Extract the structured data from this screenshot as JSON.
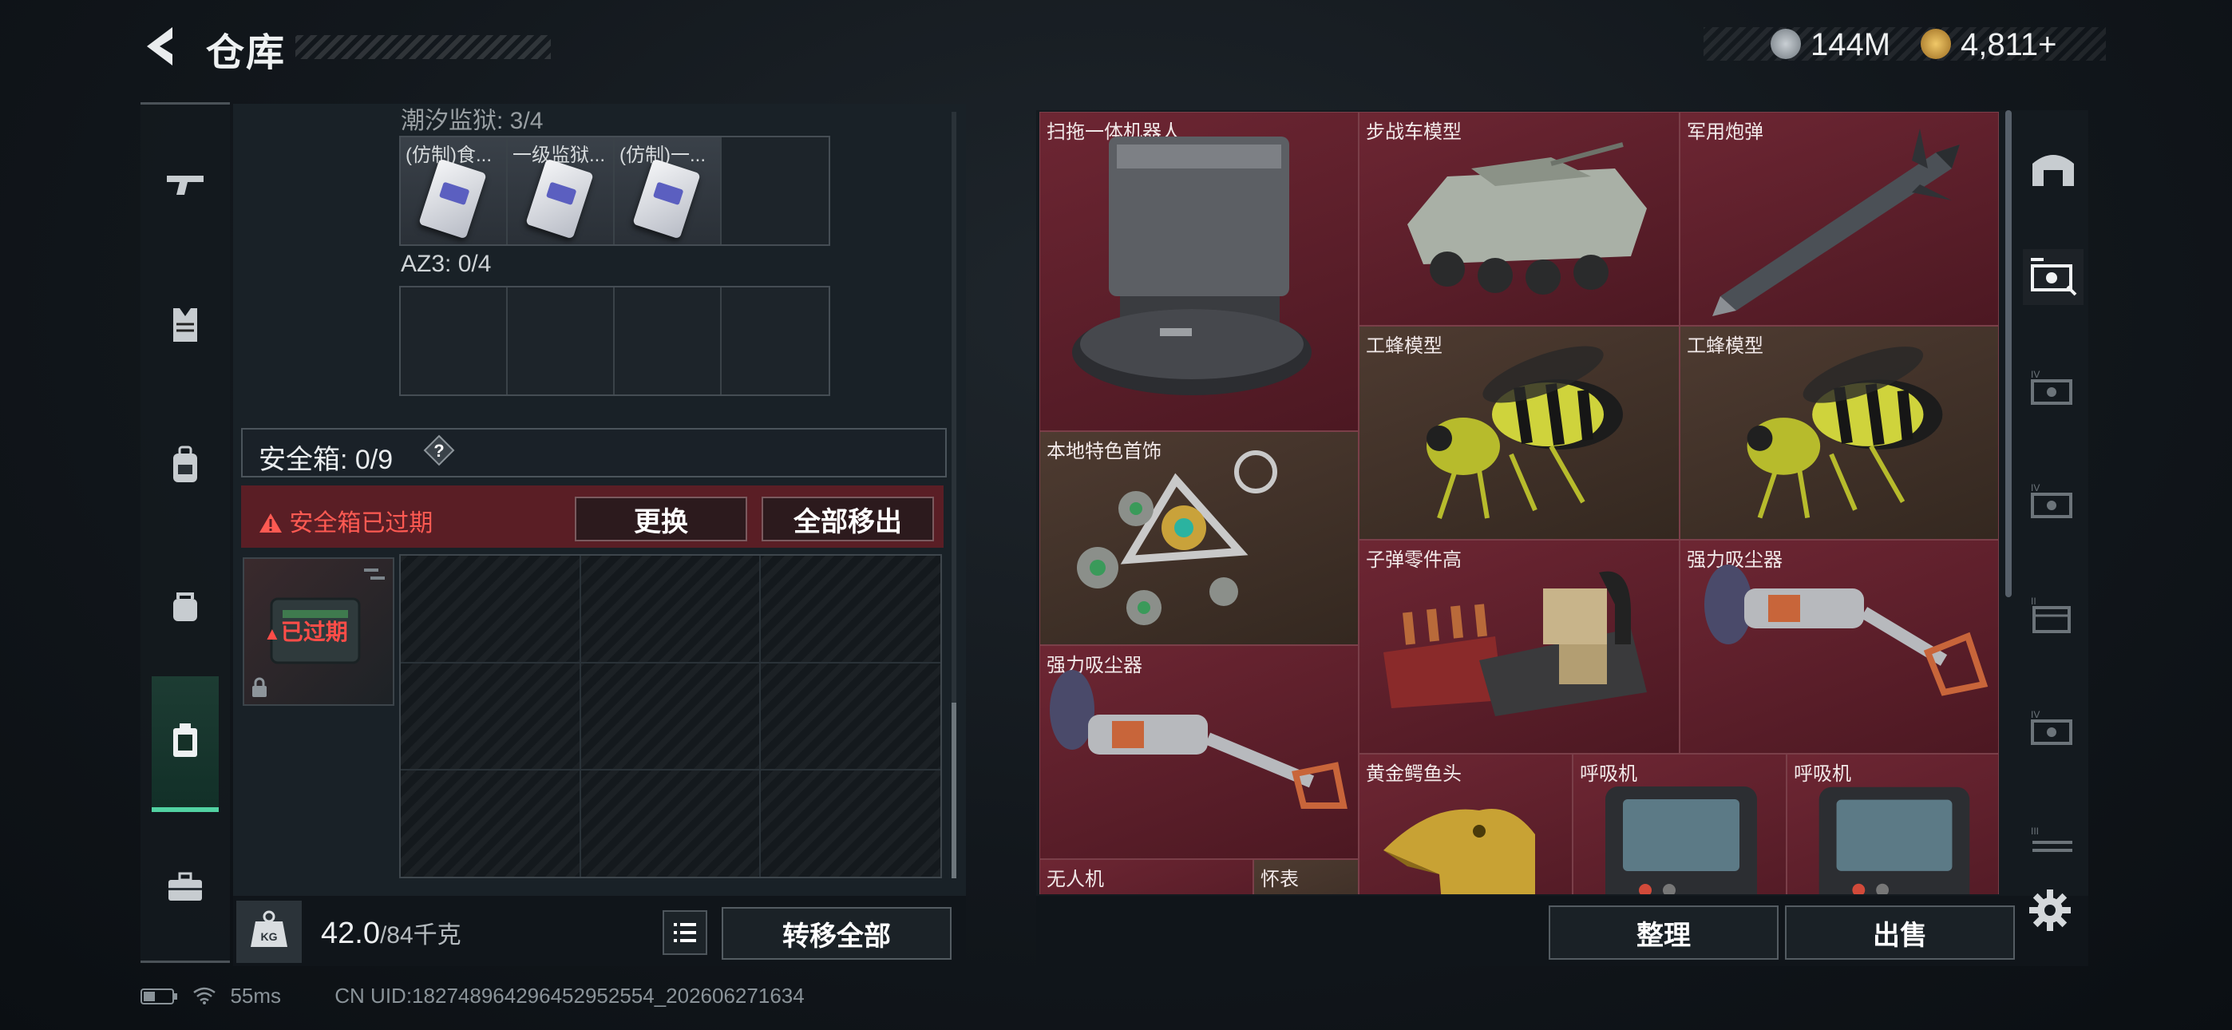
{
  "header": {
    "title": "仓库",
    "currency": [
      {
        "icon": "silver-coin-icon",
        "value": "144M"
      },
      {
        "icon": "gold-coin-icon",
        "value": "4,811+"
      }
    ]
  },
  "left_nav": [
    "gun-icon",
    "armor-vest-icon",
    "backpack-icon",
    "pouch-icon",
    "safe-box-icon",
    "toolbox-icon"
  ],
  "storage": {
    "section1_label": "潮汐监狱: 3/4",
    "section1_slots": [
      "(仿制)食...",
      "一级监狱...",
      "(仿制)一..."
    ],
    "section2_label": "AZ3: 0/4"
  },
  "safe_box": {
    "title": "安全箱: 0/9",
    "help": "?",
    "warning": "安全箱已过期",
    "replace_button": "更换",
    "move_all_button": "全部移出",
    "expired_tag": "已过期"
  },
  "weight": {
    "current": "42.0",
    "max": "/84千克"
  },
  "transfer_button": "转移全部",
  "status": {
    "ping": "55ms",
    "uid": "CN UID:1827489642964529525​54_202606271634"
  },
  "items": [
    {
      "name": "扫拖一体机器人",
      "icon": "robot-vacuum-icon"
    },
    {
      "name": "步战车模型",
      "icon": "armored-vehicle-icon"
    },
    {
      "name": "军用炮弹",
      "icon": "missile-icon"
    },
    {
      "name": "工蜂模型",
      "icon": "bee-icon"
    },
    {
      "name": "工蜂模型",
      "icon": "bee-icon"
    },
    {
      "name": "本地特色首饰",
      "icon": "jewelry-icon"
    },
    {
      "name": "子弹零件高",
      "icon": "bullet-parts-icon"
    },
    {
      "name": "强力吸尘器",
      "icon": "vacuum-icon"
    },
    {
      "name": "强力吸尘器",
      "icon": "vacuum-icon"
    },
    {
      "name": "黄金鳄鱼头",
      "icon": "gold-crocodile-icon"
    },
    {
      "name": "呼吸机",
      "icon": "ventilator-icon"
    },
    {
      "name": "呼吸机",
      "icon": "ventilator-icon"
    },
    {
      "name": "无人机",
      "icon": "drone-icon"
    },
    {
      "name": "怀表",
      "icon": "pocket-watch-icon"
    }
  ],
  "right_footer": {
    "sort_button": "整理",
    "sell_button": "出售"
  },
  "right_nav": [
    "home-icon",
    "storage-tab-1-icon",
    "storage-tab-2-icon",
    "storage-tab-3-icon",
    "storage-tab-4-icon",
    "storage-tab-5-icon",
    "storage-tab-6-icon"
  ],
  "colors": {
    "accent": "#52d2a2",
    "warning": "#ff5a52",
    "item_red": "#6d2633",
    "item_brown": "#4e3b31"
  }
}
